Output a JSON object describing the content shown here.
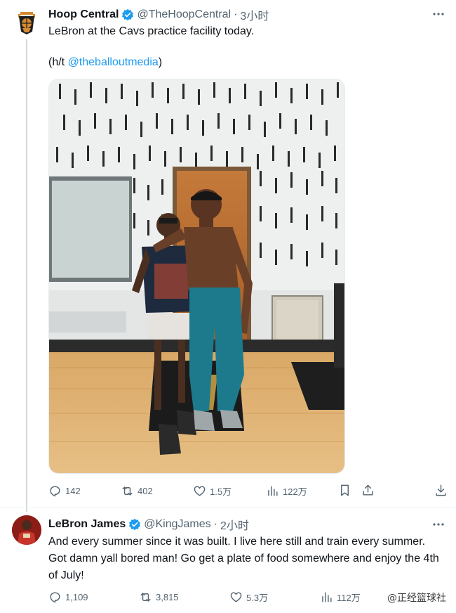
{
  "tweets": [
    {
      "author_name": "Hoop Central",
      "handle": "@TheHoopCentral",
      "separator": "·",
      "time": "3小时",
      "text_line1": "LeBron at the Cavs practice facility today.",
      "text_line2_prefix": "(h/t ",
      "mention": "@theballoutmedia",
      "text_line2_suffix": ")",
      "stats": {
        "replies": "142",
        "reposts": "402",
        "likes": "1.5万",
        "views": "122万"
      }
    },
    {
      "author_name": "LeBron James",
      "handle": "@KingJames",
      "separator": "·",
      "time": "2小时",
      "text": "And every summer since it was built. I live here still and train every summer. Got damn yall bored man! Go get a plate of food somewhere and enjoy the 4th of July!",
      "stats": {
        "replies": "1,109",
        "reposts": "3,815",
        "likes": "5.3万",
        "views": "112万"
      }
    }
  ],
  "watermark": "@正经篮球社",
  "colors": {
    "accent": "#1d9bf0",
    "text": "#0f1419",
    "muted": "#536471",
    "thread_line": "#cfd9de"
  },
  "icons": [
    "more-icon",
    "verified-badge-icon",
    "reply-icon",
    "repost-icon",
    "like-icon",
    "views-icon",
    "bookmark-icon",
    "share-icon",
    "download-icon"
  ]
}
